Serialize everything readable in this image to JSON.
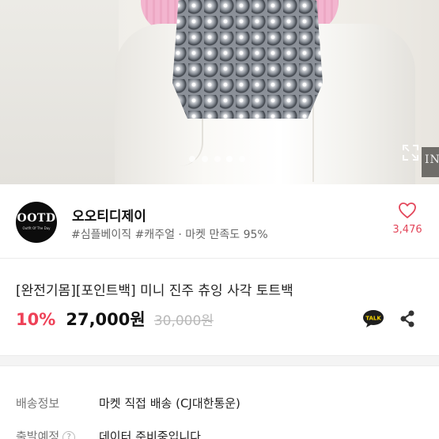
{
  "gallery": {
    "dot_count": 5,
    "active_index": 3,
    "store_sign_text": "INE"
  },
  "seller": {
    "logo_text": "OOTD",
    "logo_subtext": "Outfit Of The Day",
    "name": "오오티디제이",
    "tags": "#심플베이직 #캐주얼 · 마켓 만족도 95%",
    "likes": "3,476",
    "heart_color": "#e3465a"
  },
  "product": {
    "title": "[완전기몸][포인트백] 미니 진주 츄잉 사각 토트백",
    "discount": "10%",
    "price": "27,000원",
    "original_price": "30,000원",
    "accent_color": "#ee4157"
  },
  "shipping": {
    "rows": [
      {
        "label": "배송정보",
        "value": "마켓 직접 배송 (CJ대한통운)"
      },
      {
        "label": "출발예정",
        "value": "데이터 준비중입니다"
      }
    ]
  },
  "icons": {
    "talk": "talk-chat-icon",
    "talk_label": "TALK",
    "share": "share-icon",
    "heart": "heart-icon",
    "expand": "expand-icon",
    "help": "help-icon",
    "help_glyph": "?"
  }
}
